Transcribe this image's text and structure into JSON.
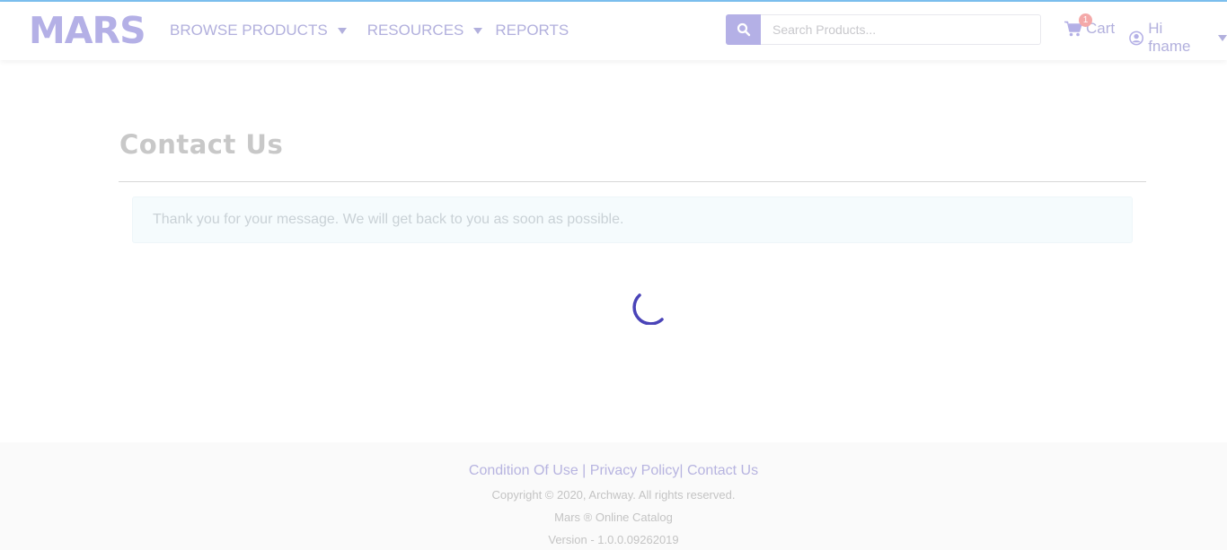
{
  "header": {
    "logo": "MARS",
    "nav": [
      {
        "label": "BROWSE PRODUCTS"
      },
      {
        "label": "RESOURCES"
      },
      {
        "label": "REPORTS"
      }
    ],
    "search": {
      "placeholder": "Search Products..."
    },
    "cart": {
      "label": "Cart",
      "count": "1"
    },
    "user": {
      "label": "Hi fname"
    }
  },
  "main": {
    "title": "Contact Us",
    "alert": "Thank you for your message. We will get back to you as soon as possible."
  },
  "footer": {
    "links": {
      "condition": "Condition Of Use",
      "sep1": " | ",
      "privacy": "Privacy Policy",
      "sep2": "| ",
      "contact": "Contact Us"
    },
    "copyright": "Copyright © 2020, Archway. All rights reserved.",
    "catalog": "Mars ® Online Catalog",
    "version": "Version - 1.0.0.09262019"
  },
  "colors": {
    "accent": "#b4b0e6",
    "spinner": "#4a44b8",
    "topline": "#7cc0ef",
    "badge": "#f4a9a9"
  },
  "icons": {
    "search": "search-icon",
    "cart": "cart-icon",
    "user": "user-circle-icon",
    "loading": "loading-spinner-icon"
  }
}
